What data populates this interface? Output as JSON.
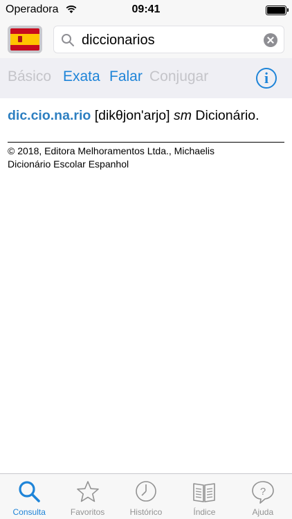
{
  "status_bar": {
    "carrier": "Operadora",
    "time": "09:41"
  },
  "search": {
    "language_flag": "Spain",
    "query": "diccionarios",
    "placeholder": ""
  },
  "options": {
    "basico": "Básico",
    "exata": "Exata",
    "falar": "Falar",
    "conjugar": "Conjugar",
    "info": "i"
  },
  "entry": {
    "headword": "dic.cio.na.rio",
    "pronunciation": "[dikθjon'arjo]",
    "part_of_speech": "sm",
    "translation": "Dicionário."
  },
  "copyright": {
    "line1": "© 2018, Editora Melhoramentos Ltda., Michaelis",
    "line2": "Dicionário Escolar Espanhol"
  },
  "tabs": [
    {
      "label": "Consulta",
      "icon": "search-icon",
      "selected": true
    },
    {
      "label": "Favoritos",
      "icon": "star-icon",
      "selected": false
    },
    {
      "label": "Histórico",
      "icon": "clock-icon",
      "selected": false
    },
    {
      "label": "Índice",
      "icon": "book-icon",
      "selected": false
    },
    {
      "label": "Ajuda",
      "icon": "help-bubble-icon",
      "selected": false
    }
  ],
  "colors": {
    "accent": "#1e84d8",
    "headword": "#2d7fc1",
    "disabled": "#c4c4c9",
    "tab_inactive": "#929292"
  }
}
